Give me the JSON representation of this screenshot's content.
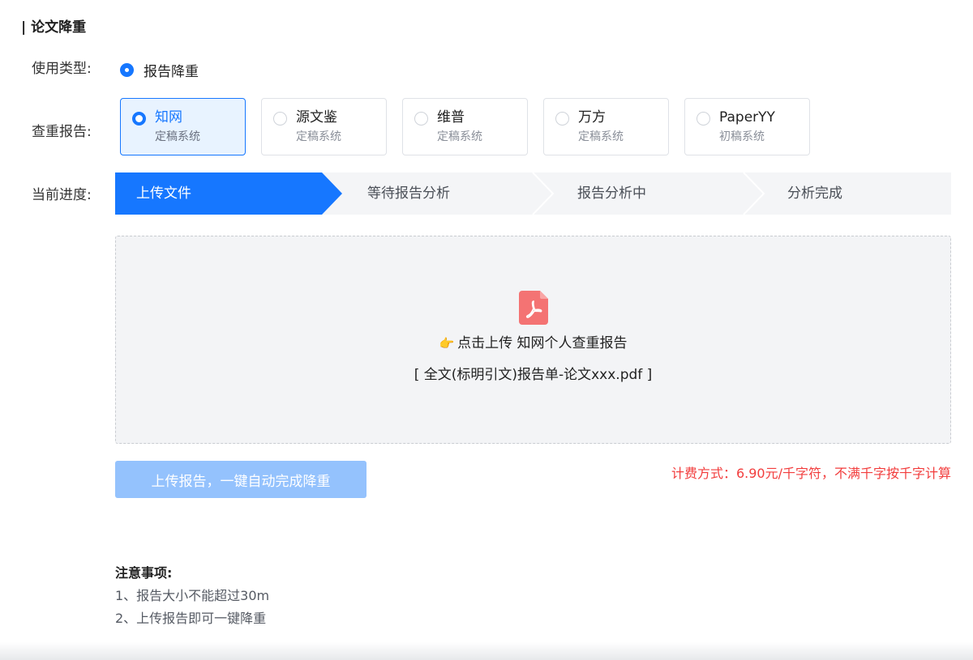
{
  "section": {
    "title": "| 论文降重"
  },
  "usage": {
    "label": "使用类型:",
    "option": "报告降重"
  },
  "report": {
    "label": "查重报告:",
    "options": [
      {
        "name": "知网",
        "sub": "定稿系统",
        "selected": true
      },
      {
        "name": "源文鉴",
        "sub": "定稿系统",
        "selected": false
      },
      {
        "name": "维普",
        "sub": "定稿系统",
        "selected": false
      },
      {
        "name": "万方",
        "sub": "定稿系统",
        "selected": false
      },
      {
        "name": "PaperYY",
        "sub": "初稿系统",
        "selected": false
      }
    ]
  },
  "progress": {
    "label": "当前进度:",
    "active_index": 0,
    "steps": [
      "上传文件",
      "等待报告分析",
      "报告分析中",
      "分析完成"
    ]
  },
  "upload": {
    "hand": "👉",
    "hint": "点击上传 知网个人查重报告",
    "sample": "[ 全文(标明引文)报告单-论文xxx.pdf ]"
  },
  "button": {
    "label": "上传报告，一键自动完成降重"
  },
  "pricing": "计费方式：6.90元/千字符，不满千字按千字计算",
  "notes": {
    "title": "注意事项:",
    "items": [
      "1、报告大小不能超过30m",
      "2、上传报告即可一键降重"
    ]
  },
  "colors": {
    "accent": "#1677ff",
    "button_disabled": "#94c2fd",
    "price_red": "#f23d3d",
    "pdf_red": "#f47373"
  }
}
